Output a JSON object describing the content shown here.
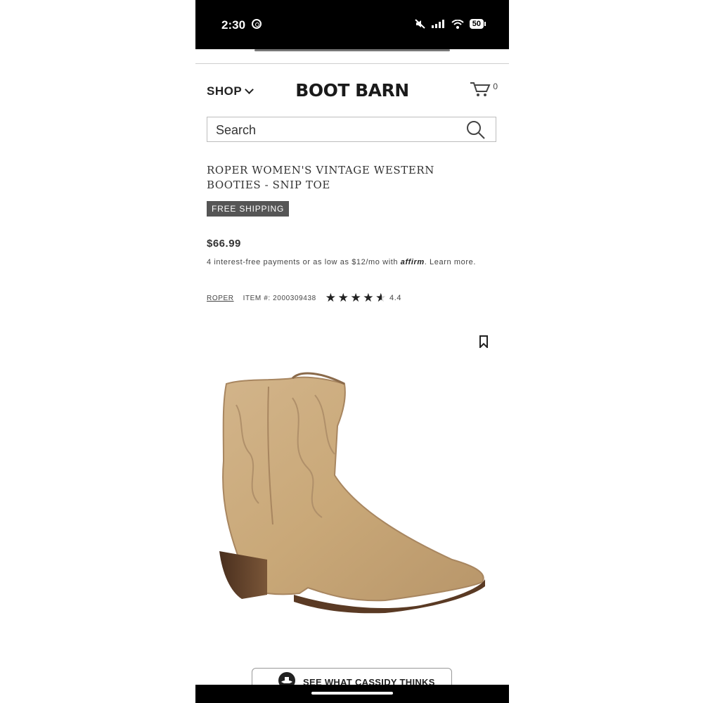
{
  "status_bar": {
    "time": "2:30",
    "battery": "50"
  },
  "header": {
    "shop_label": "SHOP",
    "logo": "BOOT BARN",
    "cart_count": "0"
  },
  "search": {
    "placeholder": "Search"
  },
  "product": {
    "title": "ROPER WOMEN'S VINTAGE WESTERN BOOTIES - SNIP TOE",
    "badge": "FREE SHIPPING",
    "price": "$66.99",
    "installments_prefix": "4 interest-free payments or as low as $12/mo with",
    "affirm": "affirm",
    "installments_suffix": ". Learn more.",
    "brand": "ROPER",
    "item_number": "ITEM #: 2000309438",
    "rating": "4.4",
    "stars_filled": 4.4,
    "stars_total": 5
  },
  "cta": {
    "label": "SEE WHAT CASSIDY THINKS"
  },
  "icons": {
    "search": "search-icon",
    "cart": "cart-icon",
    "bookmark": "bookmark-icon",
    "chevron": "chevron-down-icon"
  }
}
